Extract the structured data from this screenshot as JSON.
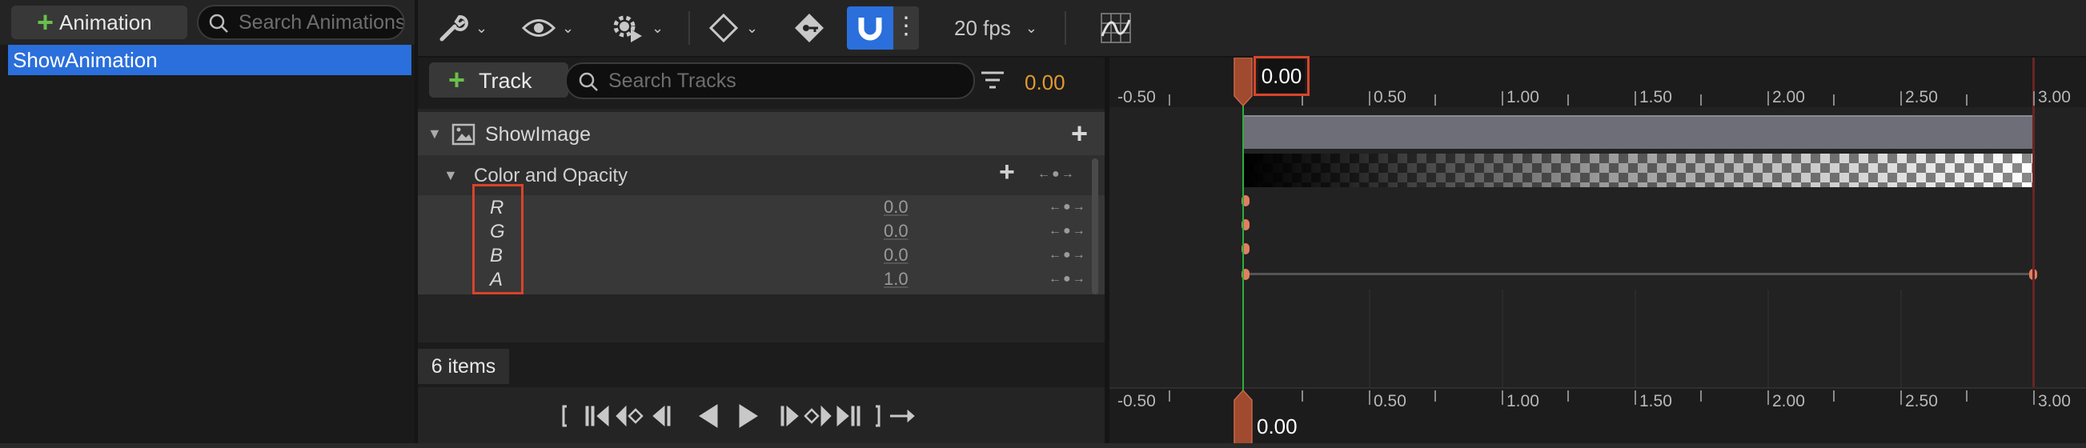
{
  "animations": {
    "add_label": "Animation",
    "search_placeholder": "Search Animations",
    "items": [
      "ShowAnimation"
    ]
  },
  "toolbar": {
    "fps": "20 fps"
  },
  "outliner": {
    "add_track_label": "Track",
    "search_placeholder": "Search Tracks",
    "current_time": "0.00",
    "items_count": "6 items",
    "widget_track": "ShowImage",
    "property_track": "Color and Opacity",
    "channels": [
      {
        "name": "R",
        "value": "0.0"
      },
      {
        "name": "G",
        "value": "0.0"
      },
      {
        "name": "B",
        "value": "0.0"
      },
      {
        "name": "A",
        "value": "1.0"
      }
    ]
  },
  "timeline": {
    "playhead_time": "0.00",
    "playhead_time_bottom": "0.00",
    "ruler_labels": [
      "-0.50",
      "0.50",
      "1.00",
      "1.50",
      "2.00",
      "2.50",
      "3.00"
    ]
  },
  "colors": {
    "accent": "#2a6fdb",
    "playhead": "#c0502f",
    "time_value": "#e09a30",
    "add_green": "#6ac04a"
  }
}
